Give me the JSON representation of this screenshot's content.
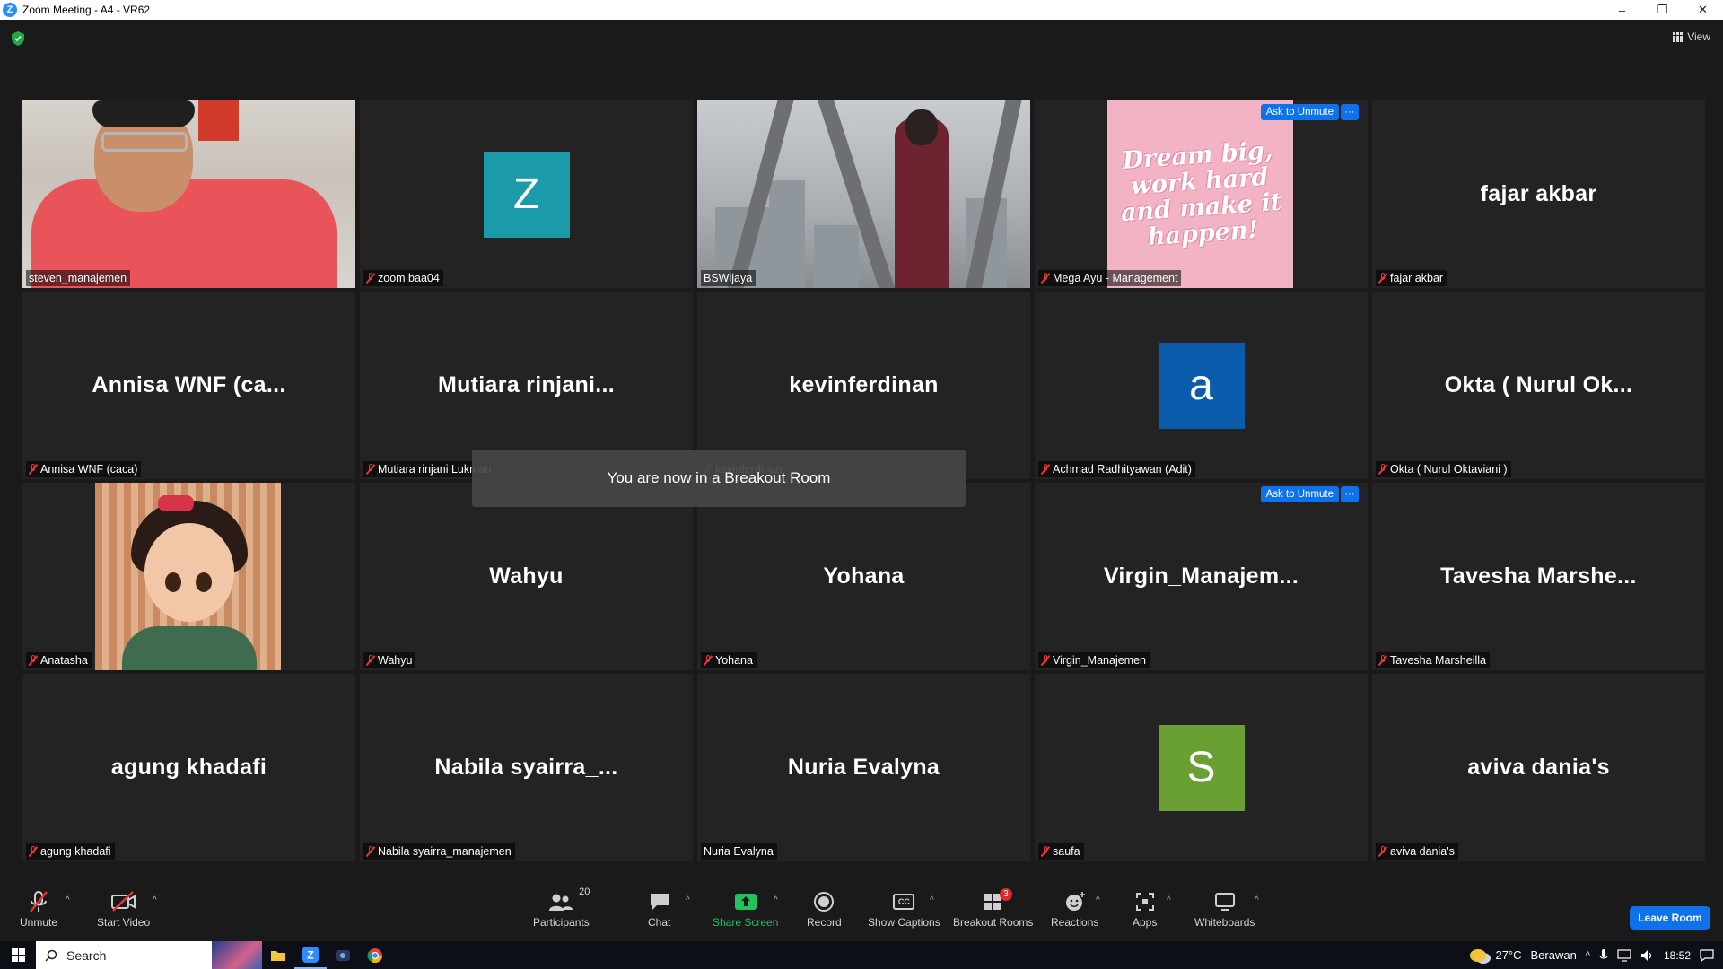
{
  "window": {
    "title": "Zoom Meeting - A4 - VR62",
    "app_icon": "Z",
    "minimize": "–",
    "maximize": "❐",
    "close": "✕"
  },
  "meeting": {
    "view_label": "View",
    "toast": "You are now in a Breakout Room",
    "ask_to_unmute": "Ask to Unmute",
    "more": "···"
  },
  "tiles": [
    {
      "label": "steven_manajemen",
      "type": "photo-steven",
      "muted": false,
      "active": true
    },
    {
      "label": "zoom baa04",
      "type": "avatar",
      "avatar": "Z",
      "avatar_color": "#1b9aaa",
      "muted": true
    },
    {
      "label": "BSWijaya",
      "type": "photo-bsw",
      "muted": false
    },
    {
      "label": "Mega Ayu - Management",
      "type": "photo-mega",
      "quote": "Dream big, work hard and make it happen!",
      "muted": true,
      "ask_unmute": true
    },
    {
      "label": "fajar akbar",
      "type": "name",
      "bigname": "fajar akbar",
      "muted": true
    },
    {
      "label": "Annisa WNF (caca)",
      "type": "name",
      "bigname": "Annisa  WNF  (ca...",
      "muted": true
    },
    {
      "label": "Mutiara rinjani Lukman",
      "type": "name",
      "bigname": "Mutiara  rinjani...",
      "muted": true
    },
    {
      "label": "kevinferdinan",
      "type": "name",
      "bigname": "kevinferdinan",
      "muted": true
    },
    {
      "label": "Achmad Radhityawan (Adit)",
      "type": "avatar",
      "avatar": "a",
      "avatar_color": "#0b5cad",
      "muted": true
    },
    {
      "label": "Okta ( Nurul Oktaviani )",
      "type": "name",
      "bigname": "Okta  ( Nurul  Ok...",
      "muted": true
    },
    {
      "label": "Anatasha",
      "type": "photo-anatasha",
      "muted": true
    },
    {
      "label": "Wahyu",
      "type": "name",
      "bigname": "Wahyu",
      "muted": true
    },
    {
      "label": "Yohana",
      "type": "name",
      "bigname": "Yohana",
      "muted": true
    },
    {
      "label": "Virgin_Manajemen",
      "type": "name",
      "bigname": "Virgin_Manajem...",
      "muted": true,
      "ask_unmute": true
    },
    {
      "label": "Tavesha Marsheilla",
      "type": "name",
      "bigname": "Tavesha  Marshe...",
      "muted": true
    },
    {
      "label": "agung khadafi",
      "type": "name",
      "bigname": "agung  khadafi",
      "muted": true
    },
    {
      "label": "Nabila syairra_manajemen",
      "type": "name",
      "bigname": "Nabila  syairra_...",
      "muted": true
    },
    {
      "label": "Nuria Evalyna",
      "type": "name",
      "bigname": "Nuria  Evalyna",
      "muted": false
    },
    {
      "label": "saufa",
      "type": "avatar",
      "avatar": "S",
      "avatar_color": "#6aa033",
      "muted": true
    },
    {
      "label": "aviva dania's",
      "type": "name",
      "bigname": "aviva  dania's",
      "muted": true
    }
  ],
  "toolbar": {
    "unmute": "Unmute",
    "start_video": "Start Video",
    "participants": "Participants",
    "participants_count": "20",
    "chat": "Chat",
    "share_screen": "Share Screen",
    "record": "Record",
    "show_captions": "Show Captions",
    "captions_icon": "CC",
    "breakout_rooms": "Breakout Rooms",
    "breakout_count": "3",
    "reactions": "Reactions",
    "apps": "Apps",
    "whiteboards": "Whiteboards",
    "leave_room": "Leave Room",
    "caret": "^"
  },
  "taskbar": {
    "search_placeholder": "Search",
    "weather_temp": "27°C",
    "weather_desc": "Berawan",
    "time": "18:52"
  },
  "colors": {
    "accent": "#0e72ed",
    "share_green": "#22c25f",
    "muted_red": "#e63535",
    "active_speaker": "#f4f28a"
  }
}
